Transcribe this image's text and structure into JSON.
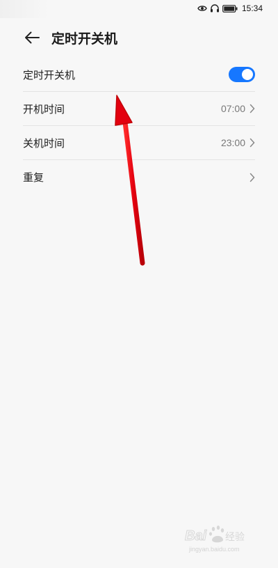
{
  "status_bar": {
    "time": "15:34",
    "icons": [
      "eye-icon",
      "headphones-icon",
      "battery-icon"
    ]
  },
  "header": {
    "back_icon": "arrow-left-icon",
    "title": "定时开关机"
  },
  "settings": {
    "items": [
      {
        "label": "定时开关机",
        "control": "toggle",
        "on": true
      },
      {
        "label": "开机时间",
        "value": "07:00",
        "icon": "chevron-right-icon"
      },
      {
        "label": "关机时间",
        "value": "23:00",
        "icon": "chevron-right-icon"
      },
      {
        "label": "重复",
        "value": "",
        "icon": "chevron-right-icon"
      }
    ]
  },
  "annotation": {
    "icon": "red-arrow-icon",
    "color": "#e3000f"
  },
  "watermark": {
    "logo_text": "Baidu经验",
    "url": "jingyan.baidu.com"
  },
  "colors": {
    "accent": "#1677ff",
    "background": "#f7f7f7"
  }
}
